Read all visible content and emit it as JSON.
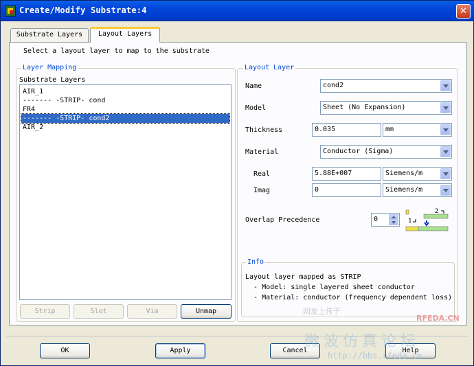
{
  "window": {
    "title": "Create/Modify Substrate:4",
    "close_label": "✕"
  },
  "tabs": [
    {
      "label": "Substrate Layers"
    },
    {
      "label": "Layout Layers"
    }
  ],
  "instruction": "Select a layout layer to map to the substrate",
  "layer_mapping": {
    "group_title": "Layer Mapping",
    "list_title": "Substrate Layers",
    "items": [
      {
        "label": "AIR_1"
      },
      {
        "label": "------- -STRIP- cond"
      },
      {
        "label": "FR4"
      },
      {
        "label": "------- -STRIP- cond2"
      },
      {
        "label": "AIR_2"
      }
    ],
    "buttons": {
      "strip": "Strip",
      "slot": "Slot",
      "via": "Via",
      "unmap": "Unmap"
    }
  },
  "layout_layer": {
    "group_title": "Layout Layer",
    "name_label": "Name",
    "name_value": "cond2",
    "model_label": "Model",
    "model_value": "Sheet (No Expansion)",
    "thickness_label": "Thickness",
    "thickness_value": "0.035",
    "thickness_unit": "mm",
    "material_label": "Material",
    "material_value": "Conductor (Sigma)",
    "real_label": "Real",
    "real_value": "5.88E+007",
    "real_unit": "Siemens/m",
    "imag_label": "Imag",
    "imag_value": "0",
    "imag_unit": "Siemens/m",
    "overlap_label": "Overlap Precedence",
    "overlap_value": "0",
    "overlap_diagram_labels": {
      "top": "2",
      "bottom": "1"
    }
  },
  "info": {
    "group_title": "Info",
    "lines": [
      "Layout layer mapped as STRIP",
      "  - Model: single layered sheet conductor",
      "  - Material: conductor (frequency dependent loss)"
    ]
  },
  "footer": {
    "ok": "OK",
    "apply": "Apply",
    "cancel": "Cancel",
    "help": "Help"
  },
  "watermark": {
    "line1": "网友上传于",
    "line2": "RFEDA.CN",
    "line3": "微波仿真论坛",
    "line4": "http://bbs.rfeda.cn"
  }
}
